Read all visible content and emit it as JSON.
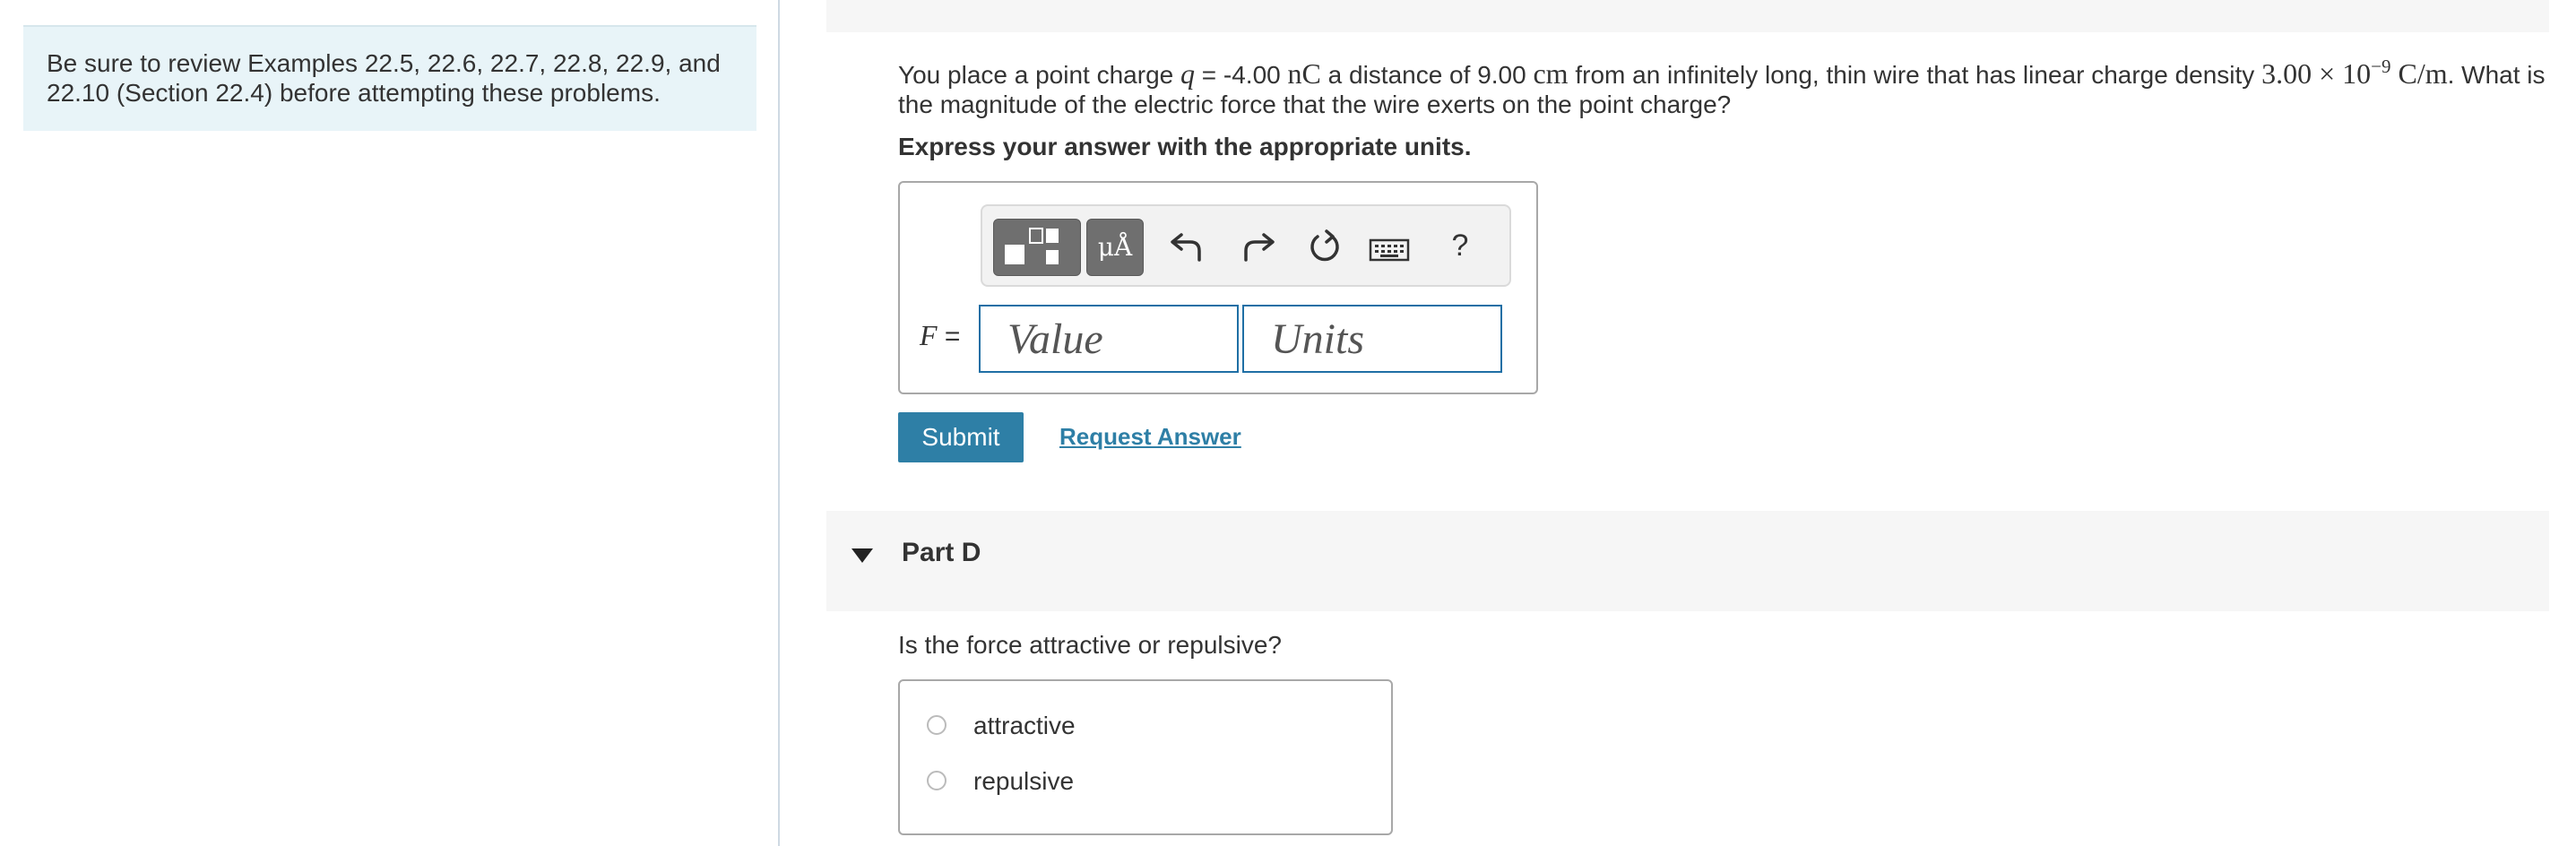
{
  "sidebar": {
    "note_line1": "Be sure to review Examples 22.5, 22.6, 22.7, 22.8, 22.9, and",
    "note_line2": "22.10 (Section 22.4) before attempting these problems."
  },
  "question": {
    "t1": "You place a point charge ",
    "q_symbol": "q",
    "t2": " = -4.00 ",
    "unit_nC": "nC",
    "t3": " a distance of 9.00 ",
    "unit_cm": "cm",
    "t4": " from an infinitely long, thin wire that has linear charge density ",
    "density_value": "3.00 × 10",
    "density_exp": "−9",
    "density_unit": " C/m",
    "t5": ". What is the magnitude of the electric force that the wire exerts on the point charge?"
  },
  "instruction": "Express your answer with the appropriate units.",
  "answer": {
    "variable": "F",
    "equals": " =",
    "value_placeholder": "Value",
    "units_placeholder": "Units"
  },
  "toolbar": {
    "template_icon": "templates-icon",
    "mu_label": "μÅ",
    "undo_icon": "undo-icon",
    "redo_icon": "redo-icon",
    "reset_icon": "reset-icon",
    "keyboard_icon": "keyboard-icon",
    "help_label": "?"
  },
  "actions": {
    "submit_label": "Submit",
    "request_label": "Request Answer"
  },
  "part_d": {
    "title": "Part D",
    "question": "Is the force attractive or repulsive?",
    "options": [
      "attractive",
      "repulsive"
    ]
  },
  "colors": {
    "accent": "#2e7fa6",
    "input_border": "#1f6fa5",
    "note_bg": "#e8f4f8"
  }
}
